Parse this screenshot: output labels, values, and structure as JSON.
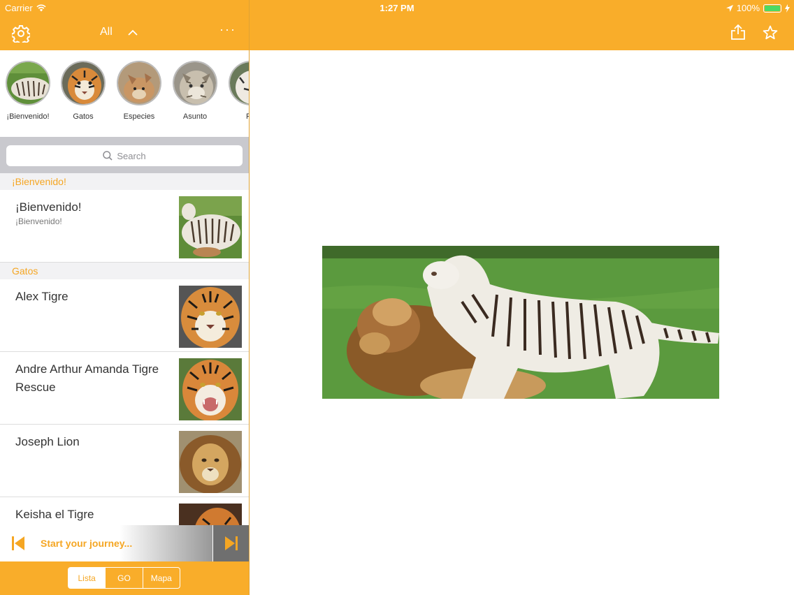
{
  "status_bar": {
    "carrier": "Carrier",
    "time": "1:27 PM",
    "battery": "100%"
  },
  "sidebar_nav": {
    "filter_label": "All",
    "more_label": "···"
  },
  "categories": [
    {
      "label": "¡Bienvenido!"
    },
    {
      "label": "Gatos"
    },
    {
      "label": "Especies"
    },
    {
      "label": "Asunto"
    },
    {
      "label": "Re"
    }
  ],
  "search": {
    "placeholder": "Search"
  },
  "sections": [
    {
      "header": "¡Bienvenido!",
      "rows": [
        {
          "title": "¡Bienvenido!",
          "subtitle": "¡Bienvenido!"
        }
      ]
    },
    {
      "header": "Gatos",
      "rows": [
        {
          "title": "Alex Tigre"
        },
        {
          "title": "Andre Arthur Amanda Tigre Rescue"
        },
        {
          "title": "Joseph Lion"
        },
        {
          "title": "Keisha el Tigre"
        }
      ]
    }
  ],
  "journey": {
    "text": "Start your journey..."
  },
  "tabs": [
    {
      "label": "Lista",
      "active": true
    },
    {
      "label": "GO",
      "active": false
    },
    {
      "label": "Mapa",
      "active": false
    }
  ],
  "colors": {
    "accent": "#f9ad2a",
    "section_text": "#f5a623",
    "battery": "#4cd964"
  }
}
